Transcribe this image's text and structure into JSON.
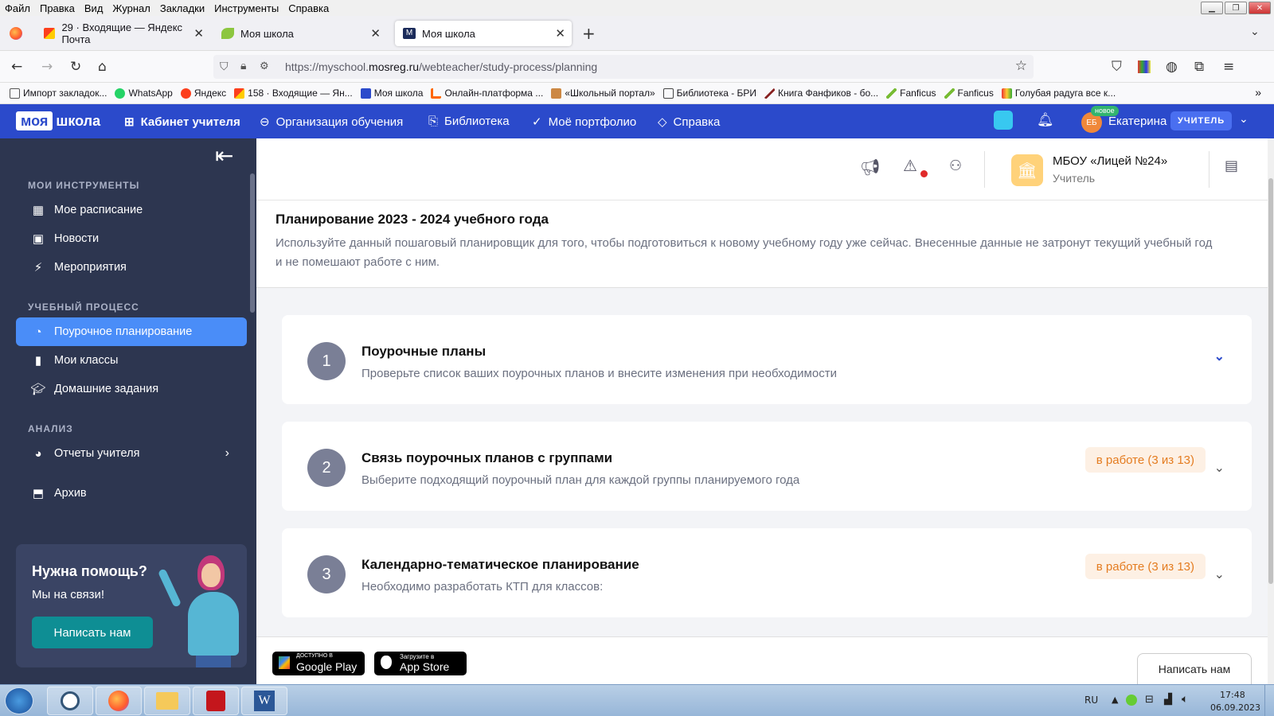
{
  "browser": {
    "menu": [
      "Файл",
      "Правка",
      "Вид",
      "Журнал",
      "Закладки",
      "Инструменты",
      "Справка"
    ],
    "tabs": [
      {
        "title": "29 · Входящие — Яндекс Почта",
        "active": false
      },
      {
        "title": "Моя школа",
        "active": false
      },
      {
        "title": "Моя школа",
        "active": true
      }
    ],
    "url_prefix": "https://myschool.",
    "url_domain": "mosreg.ru",
    "url_path": "/webteacher/study-process/planning",
    "bookmarks": [
      "Импорт закладок...",
      "WhatsApp",
      "Яндекс",
      "158 · Входящие — Ян...",
      "Моя школа",
      "Онлайн-платформа ...",
      "«Школьный портал»",
      "Библиотека - БРИ",
      "Книга Фанфиков - бо...",
      "Fanficus",
      "Fanficus",
      "Голубая радуга все к..."
    ]
  },
  "header": {
    "logo_a": "моя",
    "logo_b": "школа",
    "nav": [
      "Кабинет учителя",
      "Организация обучения",
      "Библиотека",
      "Моё портфолио",
      "Справка"
    ],
    "user_initials": "ЕБ",
    "new_badge": "новое",
    "user_name": "Екатерина",
    "role_badge": "УЧИТЕЛЬ"
  },
  "sidebar": {
    "sections": [
      {
        "title": "МОИ ИНСТРУМЕНТЫ",
        "items": [
          "Мое расписание",
          "Новости",
          "Мероприятия"
        ]
      },
      {
        "title": "УЧЕБНЫЙ ПРОЦЕСС",
        "items": [
          "Поурочное планирование",
          "Мои классы",
          "Домашние задания"
        ]
      },
      {
        "title": "АНАЛИЗ",
        "items": [
          "Отчеты учителя",
          "Архив"
        ]
      }
    ],
    "help_title": "Нужна помощь?",
    "help_sub": "Мы на связи!",
    "help_button": "Написать нам"
  },
  "org": {
    "name": "МБОУ «Лицей №24»",
    "role": "Учитель"
  },
  "planning": {
    "title": "Планирование 2023 - 2024 учебного года",
    "description": "Используйте данный пошаговый планировщик для того, чтобы подготовиться к новому учебному году уже сейчас. Внесенные данные не затронут текущий учебный год и не помешают работе с ним.",
    "steps": [
      {
        "num": "1",
        "title": "Поурочные планы",
        "sub": "Проверьте список ваших поурочных планов и внесите изменения при необходимости",
        "badge": ""
      },
      {
        "num": "2",
        "title": "Связь поурочных планов с группами",
        "sub": "Выберите подходящий поурочный план для каждой группы планируемого года",
        "badge": "в работе (3 из 13)"
      },
      {
        "num": "3",
        "title": "Календарно-тематическое планирование",
        "sub": "Необходимо разработать КТП для классов:",
        "badge": "в работе (3 из 13)"
      }
    ]
  },
  "footer": {
    "gplay_small": "ДОСТУПНО В",
    "gplay": "Google Play",
    "appstore_small": "Загрузите в",
    "appstore": "App Store",
    "write_button": "Написать нам"
  },
  "taskbar": {
    "lang": "RU",
    "time": "17:48",
    "date": "06.09.2023"
  },
  "colors": {
    "brand": "#2b4acb",
    "sidebar": "#2d3650",
    "active": "#4a8df8",
    "badge_text": "#e47c20"
  }
}
